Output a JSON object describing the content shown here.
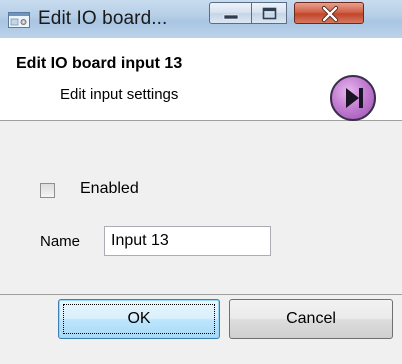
{
  "window": {
    "title": "Edit IO board..."
  },
  "header": {
    "title": "Edit IO board input 13",
    "subtitle": "Edit input settings"
  },
  "form": {
    "enabled_label": "Enabled",
    "enabled_checked": false,
    "name_label": "Name",
    "name_value": "Input 13"
  },
  "buttons": {
    "ok_label": "OK",
    "cancel_label": "Cancel"
  },
  "icons": {
    "app": "app-window-icon",
    "next": "skip-next-icon",
    "minimize": "minimize-icon",
    "maximize": "maximize-icon",
    "close": "close-icon"
  },
  "colors": {
    "titlebar": "#b4cde6",
    "close_button": "#c2452b",
    "next_button": "#c47fd3",
    "ok_button": "#bee6fd"
  }
}
